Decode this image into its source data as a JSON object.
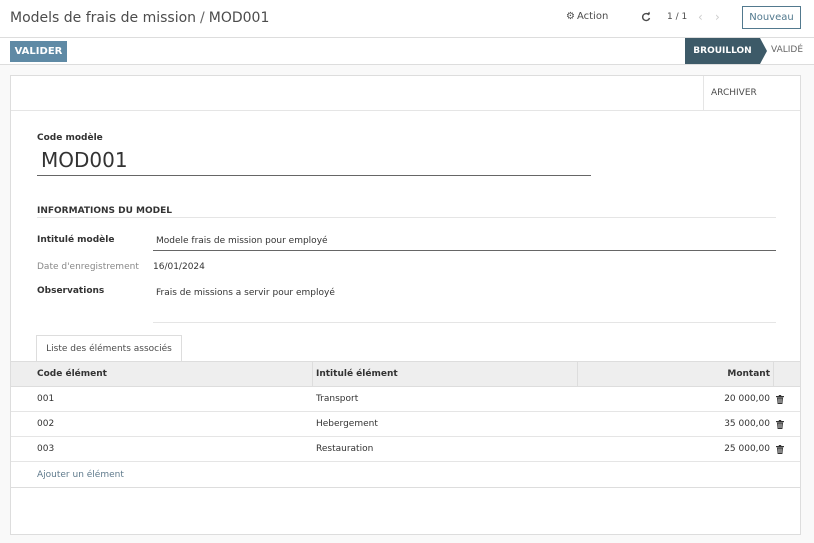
{
  "breadcrumb": {
    "parent": "Models de frais de mission",
    "separator": "/",
    "current": "MOD001"
  },
  "toolbar": {
    "action_label": "Action",
    "pager": "1 / 1",
    "new_label": "Nouveau"
  },
  "statusbar": {
    "validate_label": "VALIDER",
    "stages": [
      "BROUILLON",
      "VALIDÉ"
    ],
    "active_stage": "BROUILLON"
  },
  "sheet": {
    "archive_label": "ARCHIVER",
    "code_label": "Code modèle",
    "code_value": "MOD001",
    "group_title": "INFORMATIONS DU MODEL",
    "fields": {
      "intitule_label": "Intitulé modèle",
      "intitule_value": "Modele frais de mission pour employé",
      "date_label": "Date d'enregistrement",
      "date_value": "16/01/2024",
      "obs_label": "Observations",
      "obs_value": "Frais de missions a servir pour employé"
    },
    "tab_label": "Liste des éléments associés",
    "table": {
      "headers": [
        "Code élément",
        "Intitulé élément",
        "Montant"
      ],
      "rows": [
        {
          "code": "001",
          "intitule": "Transport",
          "montant": "20 000,00"
        },
        {
          "code": "002",
          "intitule": "Hebergement",
          "montant": "35 000,00"
        },
        {
          "code": "003",
          "intitule": "Restauration",
          "montant": "25 000,00"
        }
      ],
      "add_label": "Ajouter un élément"
    }
  },
  "icons": {
    "action": "gear-icon",
    "reload": "reload-icon",
    "prev": "chevron-left-icon",
    "next": "chevron-right-icon",
    "delete": "trash-icon"
  },
  "colors": {
    "primary": "#5f8aa5",
    "active_stage": "#3d5a68",
    "link": "#5f7a8c"
  }
}
